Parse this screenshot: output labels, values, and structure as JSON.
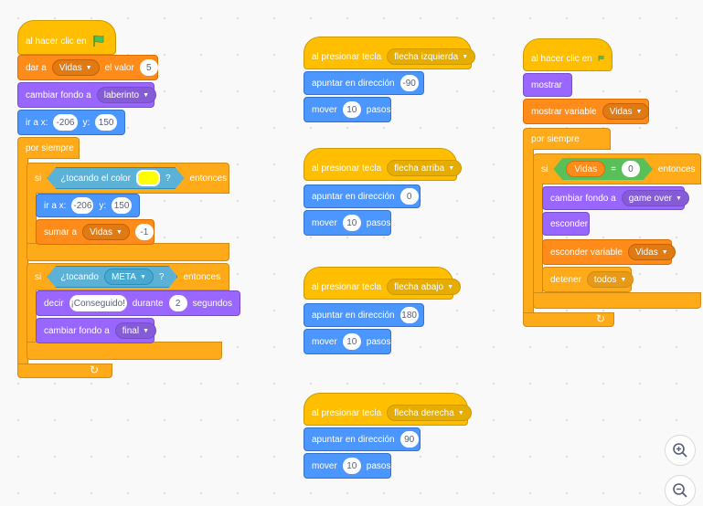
{
  "colors": {
    "events": "#ffbf00",
    "motion": "#4c97ff",
    "looks": "#9966ff",
    "variables": "#ff8c1a",
    "control": "#ffab19",
    "sensing": "#5cb1d6",
    "operators": "#59c059"
  },
  "script1": {
    "hat": "al hacer clic en",
    "set_var": {
      "label": "dar a",
      "var": "Vidas",
      "mid": "el valor",
      "value": "5"
    },
    "backdrop": {
      "label": "cambiar fondo a",
      "value": "laberinto"
    },
    "goto": {
      "label": "ir a x:",
      "x": "-206",
      "ylabel": "y:",
      "y": "150"
    },
    "forever": "por siempre",
    "if1": {
      "si": "si",
      "cond": "¿tocando el color",
      "q": "?",
      "then": "entonces"
    },
    "goto2": {
      "label": "ir a x:",
      "x": "-206",
      "ylabel": "y:",
      "y": "150"
    },
    "change": {
      "label": "sumar a",
      "var": "Vidas",
      "value": "-1"
    },
    "if2": {
      "si": "si",
      "cond": "¿tocando",
      "target": "META",
      "q": "?",
      "then": "entonces"
    },
    "say": {
      "label": "decir",
      "text": "¡Conseguido!",
      "mid": "durante",
      "secs": "2",
      "unit": "segundos"
    },
    "backdrop2": {
      "label": "cambiar fondo a",
      "value": "final"
    }
  },
  "key_scripts": [
    {
      "hat": "al presionar tecla",
      "key": "flecha izquierda",
      "point": "apuntar en dirección",
      "dir": "-90",
      "move": "mover",
      "steps": "10",
      "unit": "pasos"
    },
    {
      "hat": "al presionar tecla",
      "key": "flecha arriba",
      "point": "apuntar en dirección",
      "dir": "0",
      "move": "mover",
      "steps": "10",
      "unit": "pasos"
    },
    {
      "hat": "al presionar tecla",
      "key": "flecha abajo",
      "point": "apuntar en dirección",
      "dir": "180",
      "move": "mover",
      "steps": "10",
      "unit": "pasos"
    },
    {
      "hat": "al presionar tecla",
      "key": "flecha derecha",
      "point": "apuntar en dirección",
      "dir": "90",
      "move": "mover",
      "steps": "10",
      "unit": "pasos"
    }
  ],
  "script3": {
    "hat": "al hacer clic en",
    "show": "mostrar",
    "show_var": {
      "label": "mostrar variable",
      "var": "Vidas"
    },
    "forever": "por siempre",
    "if": {
      "si": "si",
      "var": "Vidas",
      "op": "=",
      "value": "0",
      "then": "entonces"
    },
    "backdrop": {
      "label": "cambiar fondo a",
      "value": "game over"
    },
    "hide": "esconder",
    "hide_var": {
      "label": "esconder variable",
      "var": "Vidas"
    },
    "stop": {
      "label": "detener",
      "value": "todos"
    }
  },
  "zoom": {
    "in_icon": "zoom-in-icon",
    "out_icon": "zoom-out-icon"
  }
}
